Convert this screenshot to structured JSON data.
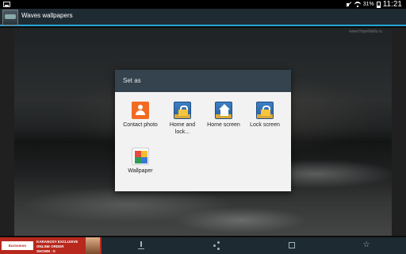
{
  "status_bar": {
    "battery_percent": "31%",
    "time": "11:21",
    "icons": [
      "screenshot-icon",
      "mute-icon",
      "wifi-icon",
      "battery-icon"
    ]
  },
  "action_bar": {
    "title": "Waves wallpapers",
    "app_icon": "waves-app-icon"
  },
  "background": {
    "watermark": "www.HopeWalls.ru"
  },
  "dialog": {
    "title": "Set as",
    "options": [
      {
        "label": "Contact photo",
        "icon": "contact-photo-icon"
      },
      {
        "label": "Home and lock...",
        "icon": "home-lock-icon"
      },
      {
        "label": "Home screen",
        "icon": "home-screen-icon"
      },
      {
        "label": "Lock screen",
        "icon": "lock-screen-icon"
      },
      {
        "label": "Wallpaper",
        "icon": "wallpaper-icon"
      }
    ]
  },
  "bottom_bar": {
    "ad": {
      "brand": "Eurosmon",
      "line1": "KARANOSY EXCLUSIVE",
      "line2": "ONLINE ORDER",
      "line3": "SHOWN ↑S"
    },
    "icons": [
      "download-icon",
      "share-icon",
      "crop-icon",
      "star-icon"
    ]
  }
}
